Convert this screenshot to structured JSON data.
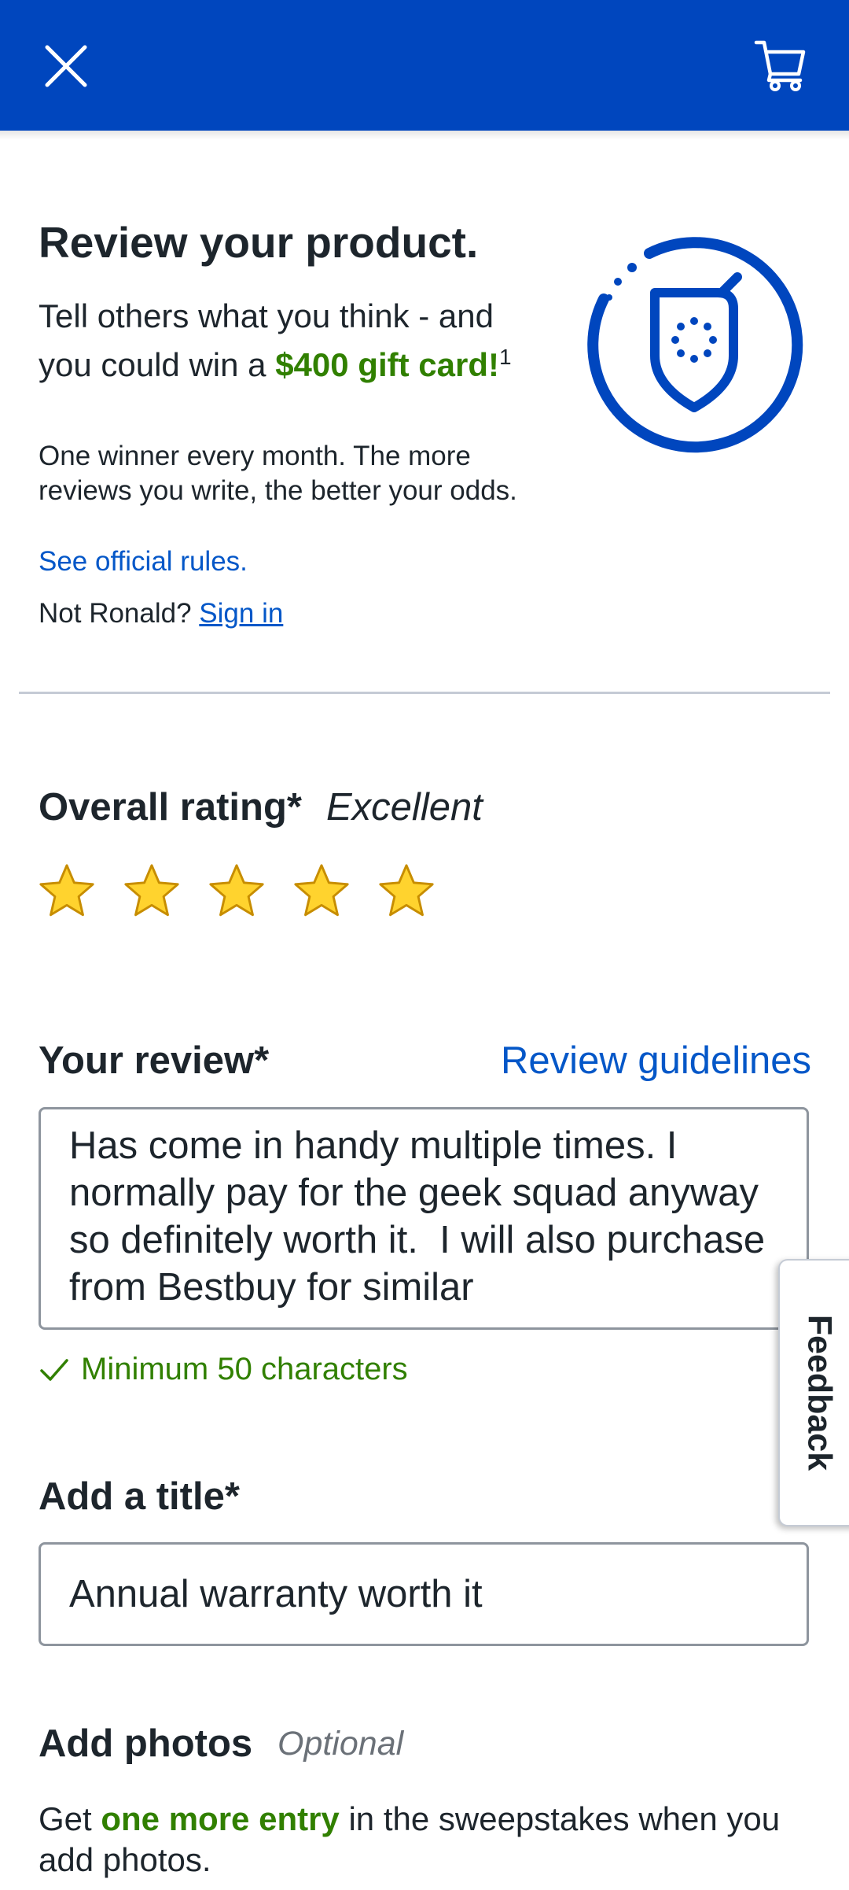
{
  "header": {
    "close_icon": "close-icon",
    "cart_icon": "cart-icon",
    "bg_color": "#0046be"
  },
  "intro": {
    "title": "Review your product.",
    "promo_before": "Tell others what you think - and you could win a ",
    "promo_highlight": "$400 gift card!",
    "promo_sup": "1",
    "details": "One winner every month. The more reviews you write, the better your odds.",
    "rules_link": "See official rules.",
    "not_user_prefix": "Not Ronald? ",
    "sign_in_link": "Sign in",
    "badge_icon": "shield-badge-icon"
  },
  "rating": {
    "label": "Overall rating*",
    "value_text": "Excellent",
    "stars_filled": 5,
    "stars_total": 5,
    "star_color": "#ffd32e"
  },
  "review": {
    "label": "Your review*",
    "guidelines_link": "Review guidelines",
    "text": "Has come in handy multiple times. I normally pay for the geek squad anyway so definitely worth it.  I will also purchase from Bestbuy for similar",
    "validation": "Minimum 50 characters"
  },
  "title_field": {
    "label": "Add a title*",
    "value": "Annual warranty worth it"
  },
  "photos": {
    "label": "Add photos",
    "optional": "Optional",
    "text_before": "Get ",
    "text_highlight": "one more entry",
    "text_after": " in the sweepstakes when you add photos."
  },
  "feedback_tab": "Feedback",
  "colors": {
    "link": "#0457c8",
    "success": "#318000",
    "brand_blue": "#0046be"
  }
}
